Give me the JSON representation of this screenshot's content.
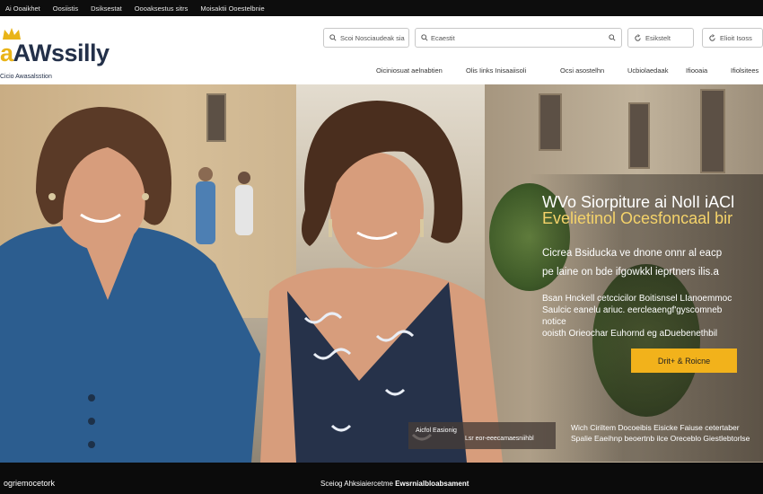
{
  "topbar": {
    "links": [
      "Ai Ooaikhet",
      "Oosiistis",
      "Dsiksestat",
      "Oooaksestus sitrs",
      "Moisaktii Ooestelbnie"
    ]
  },
  "header": {
    "logo": {
      "prefix": "a",
      "brand": "AWssilly",
      "tagline": "Cicio Awasalsstion",
      "crown_color": "#e9b418",
      "brand_color": "#233049"
    },
    "search": [
      {
        "icon": "search-icon",
        "text": "Scoi Nosciaudeak sia"
      },
      {
        "icon": "search-icon",
        "text": "Ecaestit"
      },
      {
        "icon": "refresh-icon",
        "text": "Esikstelt"
      },
      {
        "icon": "refresh-icon",
        "text": "Elioit Isoss"
      }
    ]
  },
  "nav": {
    "items": [
      "Oiciniosuat aelnabtien",
      "Olis Iinks Inisaaiisoli",
      "Ocsi asostelhn",
      "Ucbiolaedaak",
      "Ifiooaia",
      "Ifiolsitees"
    ]
  },
  "hero": {
    "title_line1": "WVo Siorpiture ai NolI iACl",
    "title_line2": "Evelietinol Ocesfoncaal bir",
    "sub_line1": "Cicrea Bsiducka ve dnone onnr al eacp",
    "sub_line2": "pe laine on bde ifgowkkl ieprtners ilis.a",
    "body_lines": [
      "Bsan Hnckell cetccicilor Boitisnsel LIanoemmoc",
      "Saulcic eanelu ariuc. eercleaengf'gyscomneb",
      "notice",
      "ooisth Orieochar Euhornd eg aDuebenethbil"
    ],
    "cta_label": "Drit+ & Roicne",
    "cta_color": "#f2b21b",
    "caption_box": [
      "Aicfol Easionig",
      "Lsr eor-eeecamaesniihbl"
    ],
    "caption_right": [
      "Wich Ciriltem Docoeibis Eisicke Faiuse cetertaber",
      "Spalie Eaeihnp beoertnb ilce Oreceblo Giestlebtorlse"
    ],
    "accent_color": "#f5d36a"
  },
  "footer": {
    "left_text": "ogriemocetork",
    "center_text": "Sceiog Ahksiaiercetme",
    "center_bold": "Ewsrnialbloabsament"
  }
}
